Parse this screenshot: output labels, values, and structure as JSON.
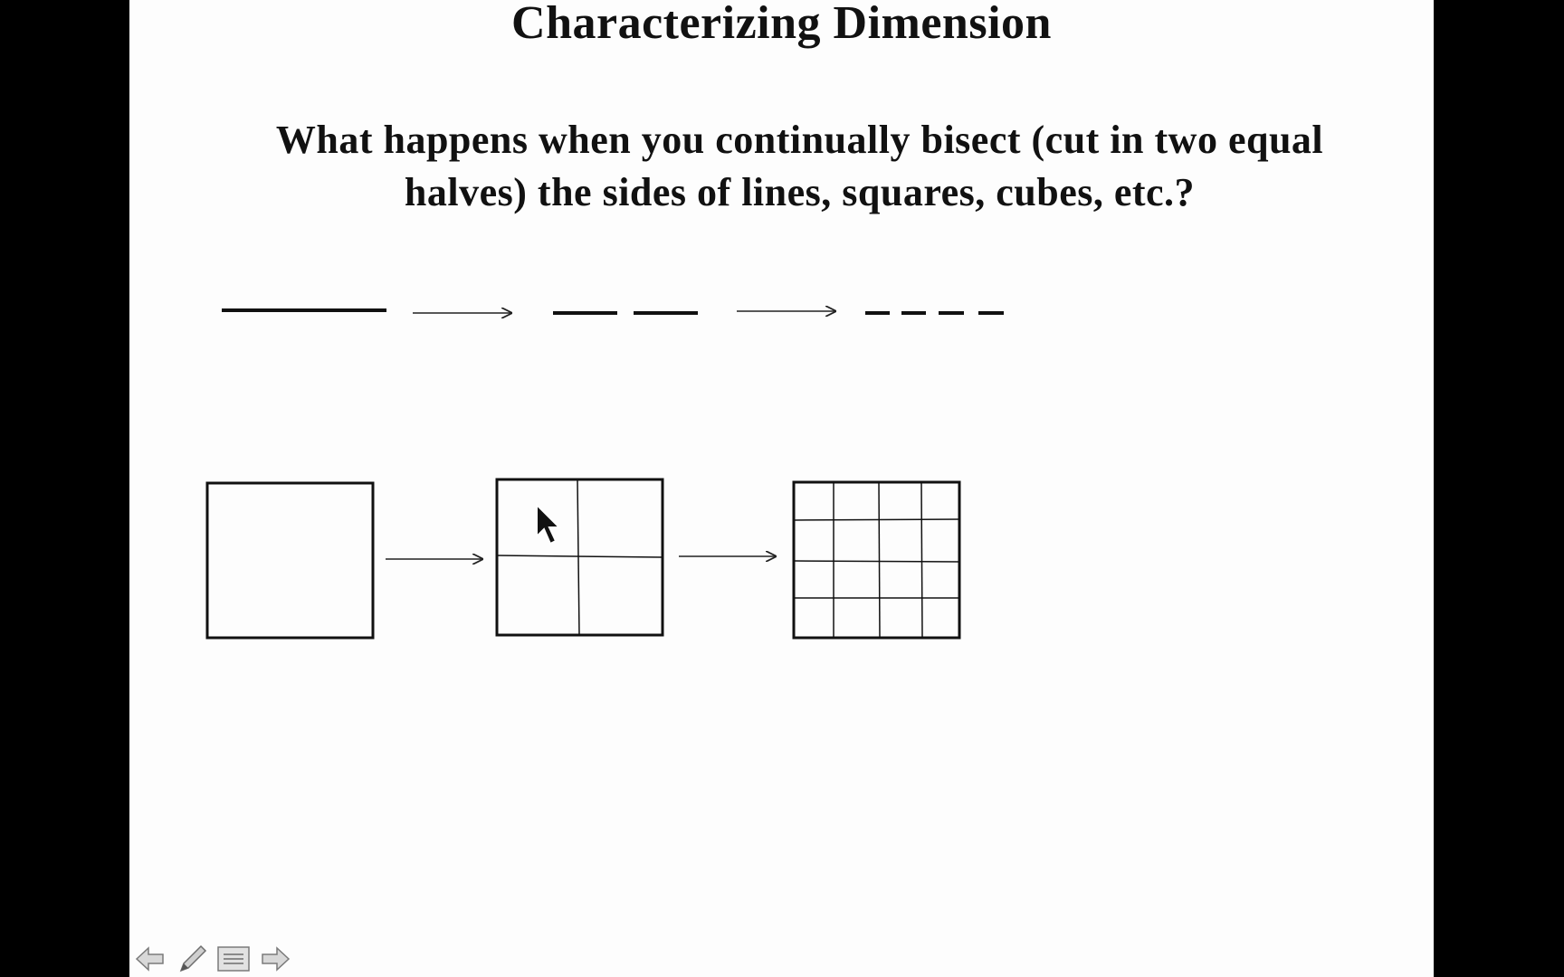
{
  "slide": {
    "title": "Characterizing Dimension",
    "question": "What happens when you continually bisect (cut in two equal halves) the sides of lines, squares, cubes, etc.?"
  },
  "toolbar": {
    "buttons": [
      {
        "name": "previous-slide-button",
        "icon": "left-arrow-icon"
      },
      {
        "name": "pen-tool-button",
        "icon": "pen-icon"
      },
      {
        "name": "slide-menu-button",
        "icon": "menu-icon"
      },
      {
        "name": "next-slide-button",
        "icon": "right-arrow-icon"
      }
    ]
  },
  "colors": {
    "background": "#000000",
    "slide": "#fdfdfd",
    "ink": "#111111"
  }
}
